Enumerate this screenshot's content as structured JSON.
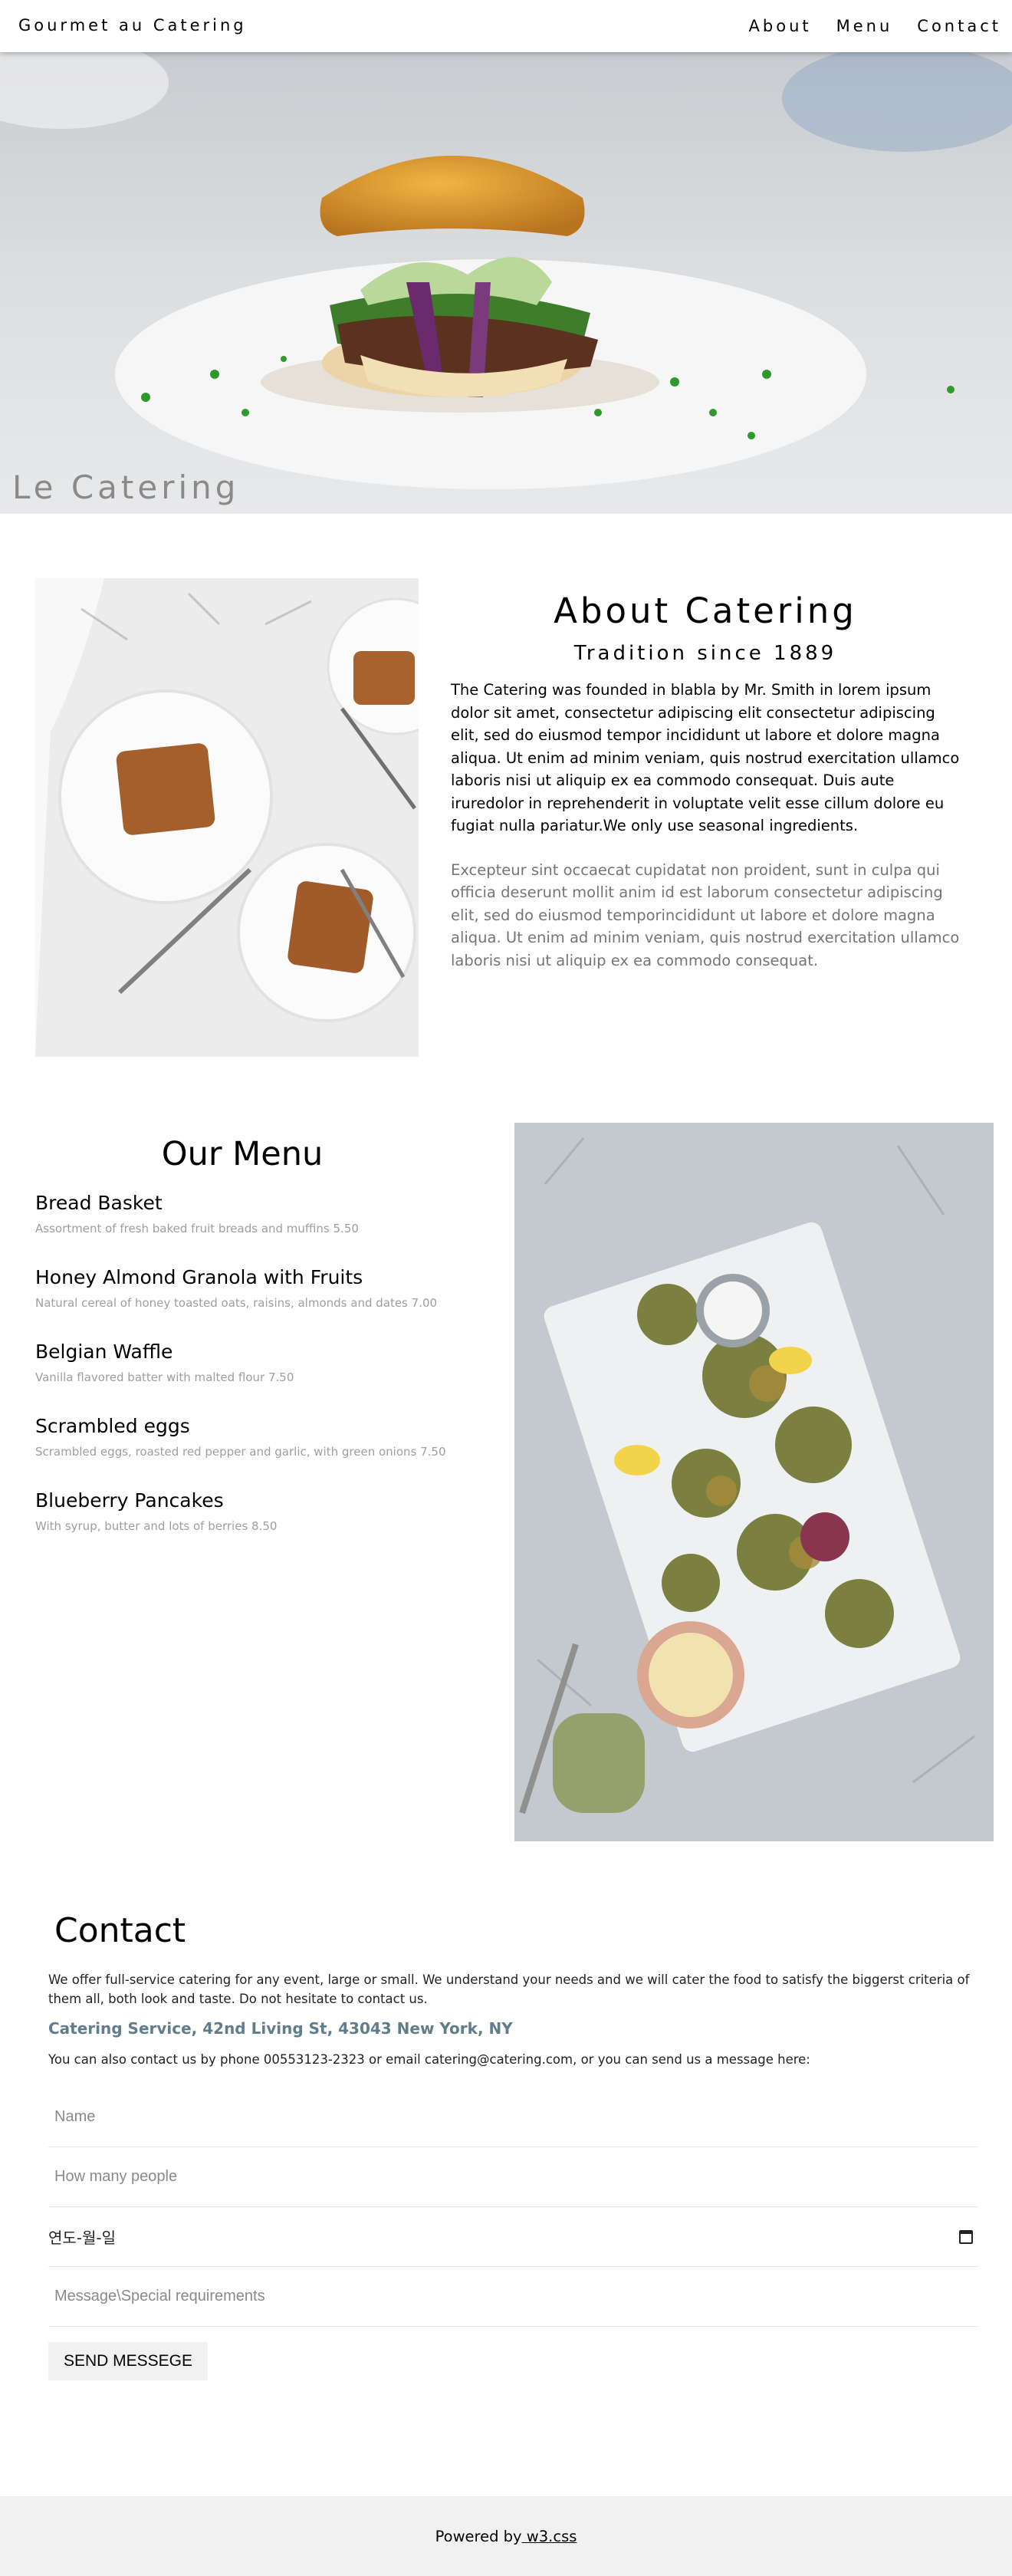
{
  "navbar": {
    "brand": "Gourmet au Catering",
    "links": [
      "About",
      "Menu",
      "Contact"
    ]
  },
  "hero": {
    "title": "Le Catering"
  },
  "about": {
    "title": "About Catering",
    "subtitle": "Tradition since 1889",
    "paragraph1": "The Catering was founded in blabla by Mr. Smith in lorem ipsum dolor sit amet, consectetur adipiscing elit consectetur adipiscing elit, sed do eiusmod tempor incididunt ut labore et dolore magna aliqua. Ut enim ad minim veniam, quis nostrud exercitation ullamco laboris nisi ut aliquip ex ea commodo consequat. Duis aute iruredolor in reprehenderit in voluptate velit esse cillum dolore eu fugiat nulla pariatur.We only use seasonal ingredients.",
    "paragraph2": "Excepteur sint occaecat cupidatat non proident, sunt in culpa qui officia deserunt mollit anim id est laborum consectetur adipiscing elit, sed do eiusmod temporincididunt ut labore et dolore magna aliqua. Ut enim ad minim veniam, quis nostrud exercitation ullamco laboris nisi ut aliquip ex ea commodo consequat."
  },
  "menu": {
    "title": "Our Menu",
    "items": [
      {
        "name": "Bread Basket",
        "desc": "Assortment of fresh baked fruit breads and muffins 5.50"
      },
      {
        "name": "Honey Almond Granola with Fruits",
        "desc": "Natural cereal of honey toasted oats, raisins, almonds and dates 7.00"
      },
      {
        "name": "Belgian Waffle",
        "desc": "Vanilla flavored batter with malted flour 7.50"
      },
      {
        "name": "Scrambled eggs",
        "desc": "Scrambled eggs, roasted red pepper and garlic, with green onions 7.50"
      },
      {
        "name": "Blueberry Pancakes",
        "desc": "With syrup, butter and lots of berries 8.50"
      }
    ]
  },
  "contact": {
    "title": "Contact",
    "intro": "We offer full-service catering for any event, large or small. We understand your needs and we will cater the food to satisfy the biggerst criteria of them all, both look and taste. Do not hesitate to contact us.",
    "address": "Catering Service, 42nd Living St, 43043 New York, NY",
    "contact_line": "You can also contact us by phone 00553123-2323 or email catering@catering.com, or you can send us a message here:",
    "form": {
      "name_placeholder": "Name",
      "people_placeholder": "How many people",
      "date_value": "연도-월-일",
      "message_placeholder": "Message\\Special requirements",
      "submit_label": "SEND MESSEGE"
    }
  },
  "footer": {
    "prefix": "Powered by",
    "link": " w3.css"
  },
  "icons": {
    "calendar": "calendar-icon"
  }
}
